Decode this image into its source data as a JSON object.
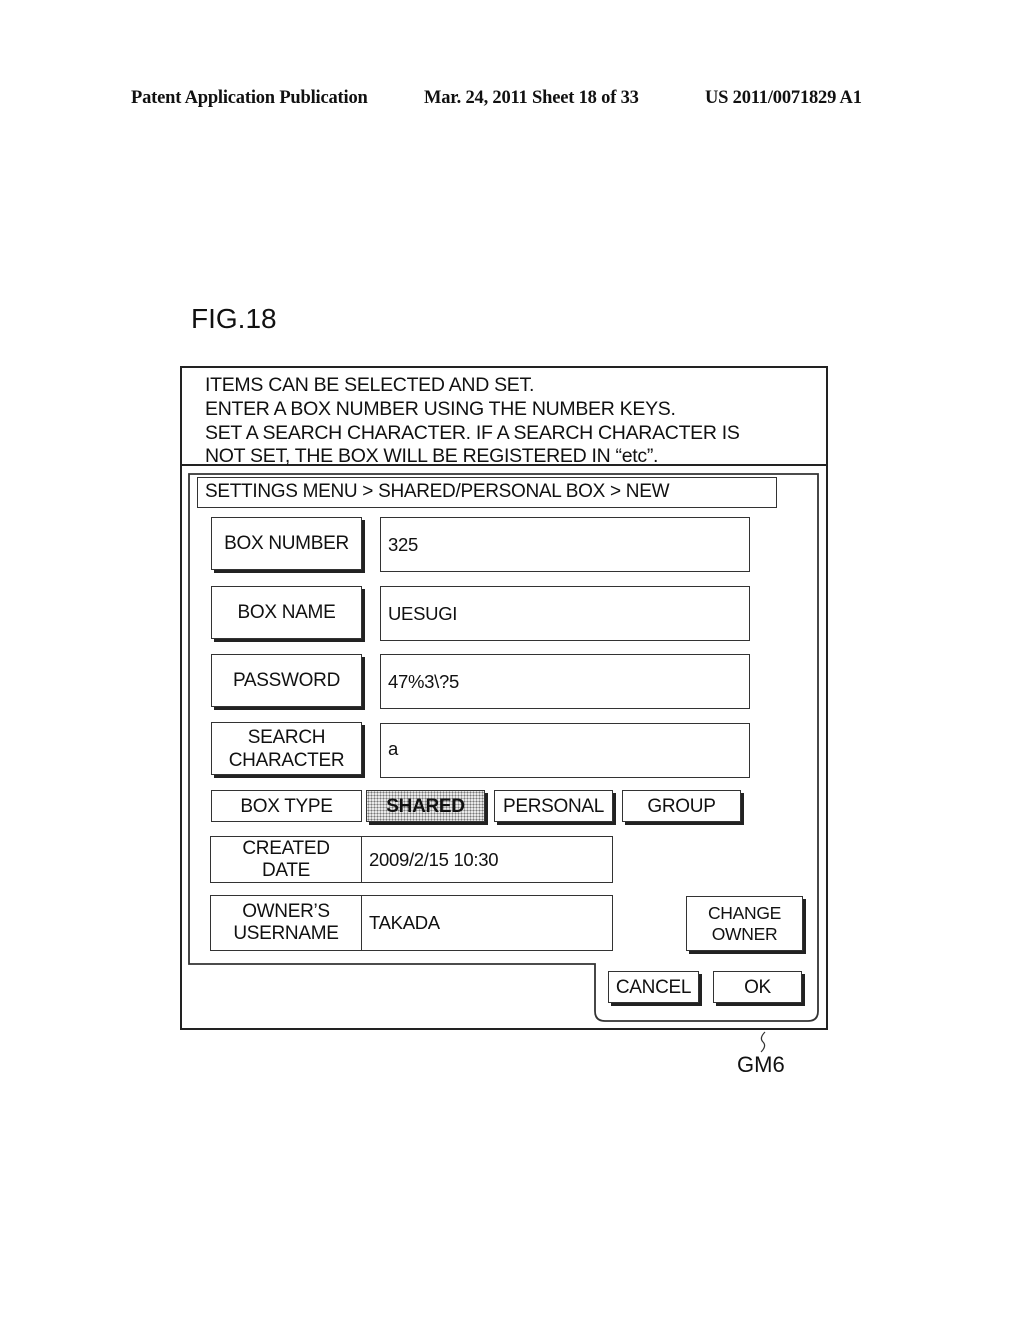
{
  "header": {
    "publication": "Patent Application Publication",
    "date_sheet": "Mar. 24, 2011  Sheet 18 of 33",
    "patent_number": "US 2011/0071829 A1"
  },
  "figure": {
    "label": "FIG.18",
    "reference": "GM6"
  },
  "message": {
    "lines": [
      "ITEMS CAN BE SELECTED AND SET.",
      "ENTER A BOX NUMBER USING THE NUMBER KEYS.",
      "SET A SEARCH CHARACTER.  IF A SEARCH CHARACTER IS",
      "NOT SET, THE BOX WILL BE REGISTERED IN “etc”."
    ]
  },
  "breadcrumb": "SETTINGS MENU > SHARED/PERSONAL BOX > NEW",
  "form": {
    "box_number": {
      "label": "BOX NUMBER",
      "value": "325"
    },
    "box_name": {
      "label": "BOX NAME",
      "value": "UESUGI"
    },
    "password": {
      "label": "PASSWORD",
      "value": "47%3\\?5"
    },
    "search_character": {
      "label_line1": "SEARCH",
      "label_line2": "CHARACTER",
      "value": "a"
    },
    "box_type": {
      "label": "BOX TYPE",
      "options": [
        "SHARED",
        "PERSONAL",
        "GROUP"
      ],
      "selected": "SHARED"
    },
    "created_date": {
      "label_line1": "CREATED",
      "label_line2": "DATE",
      "value": "2009/2/15 10:30"
    },
    "owner_username": {
      "label_line1": "OWNER’S",
      "label_line2": "USERNAME",
      "value": "TAKADA"
    }
  },
  "buttons": {
    "change_owner_line1": "CHANGE",
    "change_owner_line2": "OWNER",
    "cancel": "CANCEL",
    "ok": "OK"
  }
}
